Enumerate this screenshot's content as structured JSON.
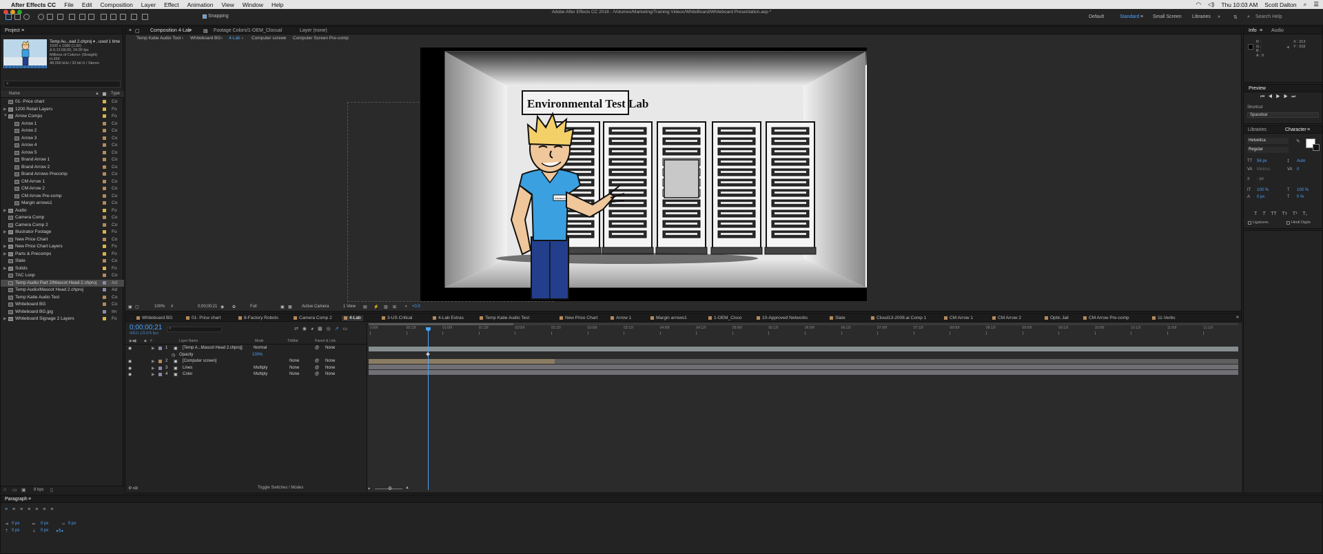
{
  "menubar": {
    "app_name": "After Effects CC",
    "items": [
      "File",
      "Edit",
      "Composition",
      "Layer",
      "Effect",
      "Animation",
      "View",
      "Window",
      "Help"
    ],
    "clock": "Thu 10:03 AM",
    "user": "Scott Dalton"
  },
  "window_title": "Adobe After Effects CC 2018 - /Volumes/Marketing/Training Videos/WhiteBoard/Whiteboard Presentation.aep *",
  "toolbar": {
    "snapping_label": "Snapping",
    "workspaces": [
      "Default",
      "Standard",
      "Small Screen",
      "Libraries"
    ],
    "active_workspace": "Standard",
    "search_placeholder": "Search Help"
  },
  "project": {
    "tab_label": "Project",
    "preview_name": "Temp Au...ead 2.chproj ▾ , used 1 time",
    "preview_lines": [
      "1920 x 1080 (1.00)",
      "Δ 0;12;08;00, 24.00 fps",
      "Millions of Colors+ (Straight)",
      "H.264",
      "48.000 kHz / 32 bit U / Stereo"
    ],
    "col_name": "Name",
    "col_type": "Type",
    "bpc": "8 bpc",
    "items": [
      {
        "name": "01- Price chart",
        "depth": 0,
        "twirl": "",
        "icon": "comp",
        "color": "#d9b34a",
        "type": "Co"
      },
      {
        "name": "1200 Retail Layers",
        "depth": 0,
        "twirl": "▶",
        "icon": "folder",
        "color": "#d9b34a",
        "type": "Fo"
      },
      {
        "name": "Arrow Comps",
        "depth": 0,
        "twirl": "▼",
        "icon": "folder",
        "color": "#d9b34a",
        "type": "Fo"
      },
      {
        "name": "Arrow 1",
        "depth": 1,
        "twirl": "",
        "icon": "comp",
        "color": "#b58a5c",
        "type": "Co"
      },
      {
        "name": "Arrow 2",
        "depth": 1,
        "twirl": "",
        "icon": "comp",
        "color": "#b58a5c",
        "type": "Co"
      },
      {
        "name": "Arrow 3",
        "depth": 1,
        "twirl": "",
        "icon": "comp",
        "color": "#b58a5c",
        "type": "Co"
      },
      {
        "name": "Arrow 4",
        "depth": 1,
        "twirl": "",
        "icon": "comp",
        "color": "#b58a5c",
        "type": "Co"
      },
      {
        "name": "Arrow 5",
        "depth": 1,
        "twirl": "",
        "icon": "comp",
        "color": "#b58a5c",
        "type": "Co"
      },
      {
        "name": "Brand Arrow 1",
        "depth": 1,
        "twirl": "",
        "icon": "comp",
        "color": "#b58a5c",
        "type": "Co"
      },
      {
        "name": "Brand Arrow 2",
        "depth": 1,
        "twirl": "",
        "icon": "comp",
        "color": "#b58a5c",
        "type": "Co"
      },
      {
        "name": "Brand Arrows Precomp",
        "depth": 1,
        "twirl": "",
        "icon": "comp",
        "color": "#b58a5c",
        "type": "Co"
      },
      {
        "name": "CM Arrow 1",
        "depth": 1,
        "twirl": "",
        "icon": "comp",
        "color": "#b58a5c",
        "type": "Co"
      },
      {
        "name": "CM Arrow 2",
        "depth": 1,
        "twirl": "",
        "icon": "comp",
        "color": "#b58a5c",
        "type": "Co"
      },
      {
        "name": "CM Arrow Pre-comp",
        "depth": 1,
        "twirl": "",
        "icon": "comp",
        "color": "#b58a5c",
        "type": "Co"
      },
      {
        "name": "Margin arrows1",
        "depth": 1,
        "twirl": "",
        "icon": "comp",
        "color": "#b58a5c",
        "type": "Co"
      },
      {
        "name": "Audio",
        "depth": 0,
        "twirl": "▶",
        "icon": "folder",
        "color": "#d9b34a",
        "type": "Fo"
      },
      {
        "name": "Camera Comp",
        "depth": 0,
        "twirl": "",
        "icon": "comp",
        "color": "#b58a5c",
        "type": "Co"
      },
      {
        "name": "Camera Comp 2",
        "depth": 0,
        "twirl": "",
        "icon": "comp",
        "color": "#b58a5c",
        "type": "Co"
      },
      {
        "name": "Illustrator Footage",
        "depth": 0,
        "twirl": "▶",
        "icon": "folder",
        "color": "#d9b34a",
        "type": "Fo"
      },
      {
        "name": "New Price Chart",
        "depth": 0,
        "twirl": "",
        "icon": "comp",
        "color": "#b58a5c",
        "type": "Co"
      },
      {
        "name": "New Price Chart Layers",
        "depth": 0,
        "twirl": "▶",
        "icon": "folder",
        "color": "#d9b34a",
        "type": "Fo"
      },
      {
        "name": "Parts & Precomps",
        "depth": 0,
        "twirl": "▶",
        "icon": "folder",
        "color": "#d9b34a",
        "type": "Fo"
      },
      {
        "name": "Slate",
        "depth": 0,
        "twirl": "",
        "icon": "comp",
        "color": "#b58a5c",
        "type": "Co"
      },
      {
        "name": "Solids",
        "depth": 0,
        "twirl": "▶",
        "icon": "folder",
        "color": "#d9b34a",
        "type": "Fo"
      },
      {
        "name": "TAC Loop",
        "depth": 0,
        "twirl": "",
        "icon": "comp",
        "color": "#b58a5c",
        "type": "Co"
      },
      {
        "name": "Temp Audio Part 2/Mascot Head 2.chproj",
        "depth": 0,
        "twirl": "",
        "icon": "ch",
        "color": "#8a8aa8",
        "type": "Ad",
        "selected": true
      },
      {
        "name": "Temp Audio/Mascot Head 2.chproj",
        "depth": 0,
        "twirl": "",
        "icon": "ch",
        "color": "#8a8aa8",
        "type": "Ad"
      },
      {
        "name": "Temp Katie Audio Test",
        "depth": 0,
        "twirl": "",
        "icon": "comp",
        "color": "#b58a5c",
        "type": "Co"
      },
      {
        "name": "Whiteboard BG",
        "depth": 0,
        "twirl": "",
        "icon": "comp",
        "color": "#b58a5c",
        "type": "Co"
      },
      {
        "name": "Whiteboard BG.jpg",
        "depth": 0,
        "twirl": "",
        "icon": "img",
        "color": "#8a8aa8",
        "type": "Im"
      },
      {
        "name": "Whiteboard Signage 2 Layers",
        "depth": 0,
        "twirl": "▶",
        "icon": "folder",
        "color": "#d9b34a",
        "type": "Fo"
      }
    ]
  },
  "viewer": {
    "tabs": [
      "Composition 4-Lab",
      "Footage Colors/1-OEM_Clocual",
      "Layer (none)"
    ],
    "breadcrumbs": [
      "Temp Katie Audio Tool",
      "Whiteboard BG",
      "4-Lab",
      "Computer screen",
      "Computer Screen Pre-comp"
    ],
    "sign_text": "Environmental Test Lab",
    "shirt_tag": "Advanced",
    "footer": {
      "zoom": "100%",
      "timecode": "0;00;00;21",
      "resolution": "Full",
      "camera": "Active Camera",
      "view": "1 View",
      "exposure": "+0.0"
    }
  },
  "info": {
    "tab_info": "Info",
    "tab_audio": "Audio",
    "r": "R :",
    "g": "G :",
    "b": "B :",
    "a": "A : 0",
    "x": "X : 313",
    "y": "Y : 318",
    "preview_label": "Preview",
    "shortcut_label": "Shortcut",
    "shortcut_value": "Spacebar"
  },
  "character": {
    "tab_libraries": "Libraries",
    "tab_character": "Character",
    "font": "Helvetica",
    "style": "Regular",
    "size": "56 px",
    "leading": "Auto",
    "kerning": "Metrics",
    "tracking": "0",
    "stroke": "- px",
    "vscale": "100 %",
    "hscale": "100 %",
    "baseline": "0 px",
    "tsume": "0 %",
    "styles": [
      "T",
      "T",
      "TT",
      "Tт",
      "T¹",
      "T₁"
    ],
    "ligatures": "Ligatures",
    "hindi": "Hindi Digits"
  },
  "timeline": {
    "comp_tabs": [
      "Whiteboard BG",
      "01- Price chart",
      "8-Factory Robots",
      "Camera Comp 2",
      "4-Lab",
      "3-US Critical",
      "4-Lab Extras",
      "Temp Katie Audio Test",
      "New Price Chart",
      "Arrow 1",
      "Margin arrows1",
      "1-OEM_Cisco",
      "10-Approved Networks",
      "Slate",
      "Cloud13-2008.ai Comp 1",
      "CM Arrow 1",
      "CM Arrow 2",
      "Optic Jail",
      "CM Arrow Pre-comp",
      "11-Verbs"
    ],
    "tab_colors": [
      "#b58a5c",
      "#b58a5c",
      "#b58a5c",
      "#b58a5c",
      "#b58a5c",
      "#b58a5c",
      "#b58a5c",
      "#b58a5c",
      "#b58a5c",
      "#b58a5c",
      "#b58a5c",
      "#b58a5c",
      "#b58a5c",
      "#b58a5c",
      "#b58a5c",
      "#b58a5c",
      "#b58a5c",
      "#b58a5c",
      "#b58a5c",
      "#b58a5c"
    ],
    "active_tab": "4-Lab",
    "timecode": "0;00;00;21",
    "frames": "00021 (23.976 fps)",
    "col_source": "Layer Name",
    "col_mode": "Mode",
    "col_trkmat": "TrkMat",
    "col_parent": "Parent & Link",
    "ruler": [
      "0:00f",
      "00:12f",
      "01:00f",
      "01:12f",
      "02:00f",
      "02:12f",
      "03:00f",
      "03:12f",
      "04:00f",
      "04:12f",
      "05:00f",
      "05:12f",
      "06:00f",
      "06:12f",
      "07:00f",
      "07:12f",
      "08:00f",
      "08:12f",
      "09:00f",
      "09:12f",
      "10:00f",
      "10:12f",
      "11:00f",
      "11:12f"
    ],
    "layers": [
      {
        "num": "1",
        "name": "[Temp A...Mascot Head 2.chproj]",
        "mode": "Normal",
        "trkmat": "",
        "parent": "None",
        "color": "#8a8aa8"
      },
      {
        "num": "",
        "name": "Opacity",
        "mode": "100%",
        "trkmat": "",
        "parent": "",
        "color": ""
      },
      {
        "num": "2",
        "name": "[Computer screen]",
        "mode": "",
        "trkmat": "None",
        "parent": "None",
        "color": "#b58a5c"
      },
      {
        "num": "3",
        "name": "Lines",
        "mode": "Multiply",
        "trkmat": "None",
        "parent": "None",
        "color": "#8a8aa8"
      },
      {
        "num": "4",
        "name": "Color",
        "mode": "Multiply",
        "trkmat": "None",
        "parent": "None",
        "color": "#8a8aa8"
      }
    ],
    "toggle_label": "Toggle Switches / Modes"
  },
  "paragraph": {
    "tab_label": "Paragraph",
    "indent_left": "0 px",
    "indent_right": "0 px",
    "indent_first": "0 px",
    "space_before": "0 px",
    "space_after": "0 px"
  }
}
